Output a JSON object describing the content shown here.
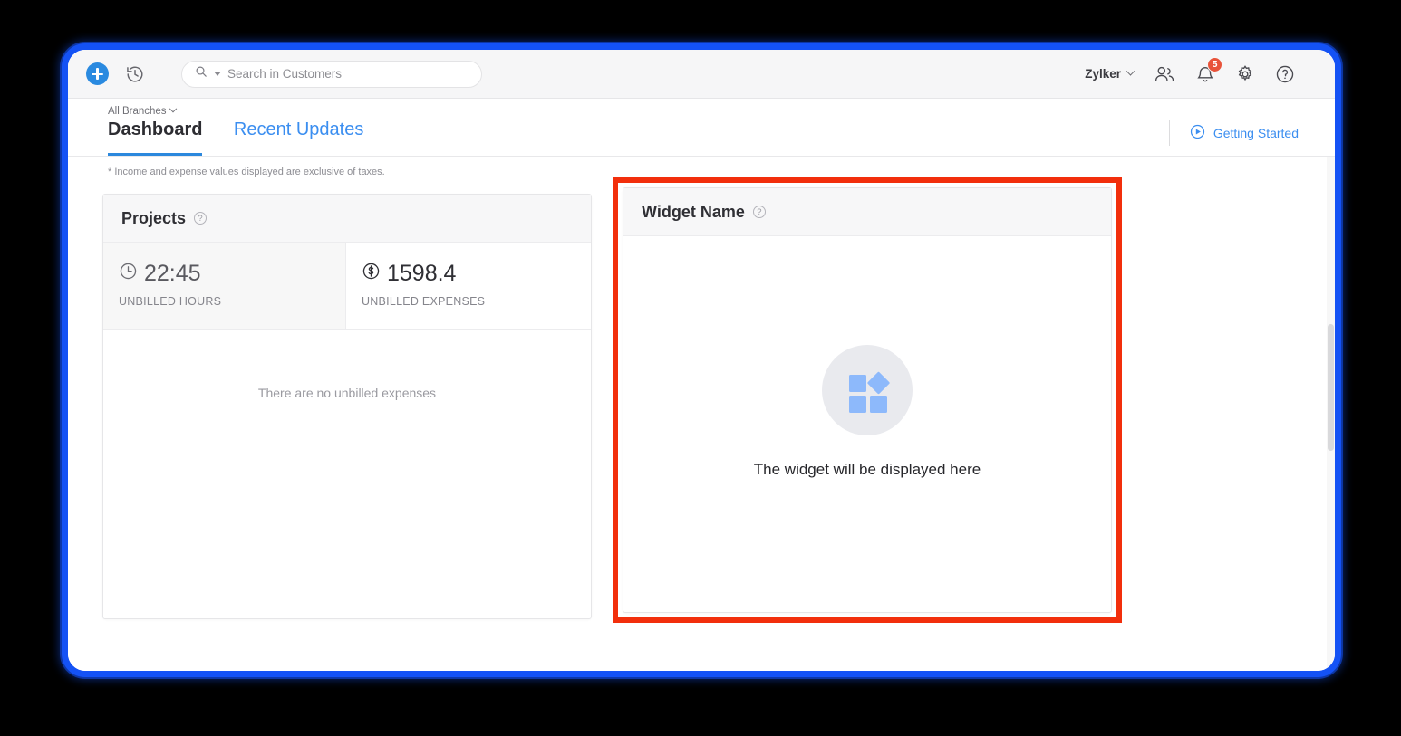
{
  "topbar": {
    "create_label": "+",
    "recent_icon": "history-clock-icon",
    "search": {
      "placeholder": "Search in Customers",
      "value": "",
      "icon": "search-icon",
      "caret": "chevron-down-icon"
    },
    "org_name": "Zylker",
    "users_icon": "users-icon",
    "bell_icon": "bell-icon",
    "bell_badge": "5",
    "settings_icon": "gear-icon",
    "help_icon": "question-circle-icon"
  },
  "header": {
    "branch_select": "All Branches",
    "tabs": [
      {
        "label": "Dashboard",
        "active": true
      },
      {
        "label": "Recent Updates",
        "active": false
      }
    ],
    "getting_started": "Getting Started",
    "getting_started_icon": "play-circle-icon"
  },
  "body": {
    "tax_note": "* Income and expense values displayed are exclusive of taxes.",
    "projects_card": {
      "title": "Projects",
      "help_icon": "question-circle-icon",
      "metrics": [
        {
          "icon": "clock-icon",
          "value": "22:45",
          "label": "UNBILLED HOURS"
        },
        {
          "icon": "dollar-circle-icon",
          "value": "1598.4",
          "label": "UNBILLED EXPENSES"
        }
      ],
      "empty_message": "There are no unbilled expenses"
    },
    "widget_card": {
      "title": "Widget Name",
      "help_icon": "question-circle-icon",
      "placeholder_icon": "widget-grid-icon",
      "placeholder_text": "The widget will be displayed here"
    }
  },
  "annotation": {
    "highlight_color": "#f22f0c",
    "frame_color": "#1452f5"
  }
}
